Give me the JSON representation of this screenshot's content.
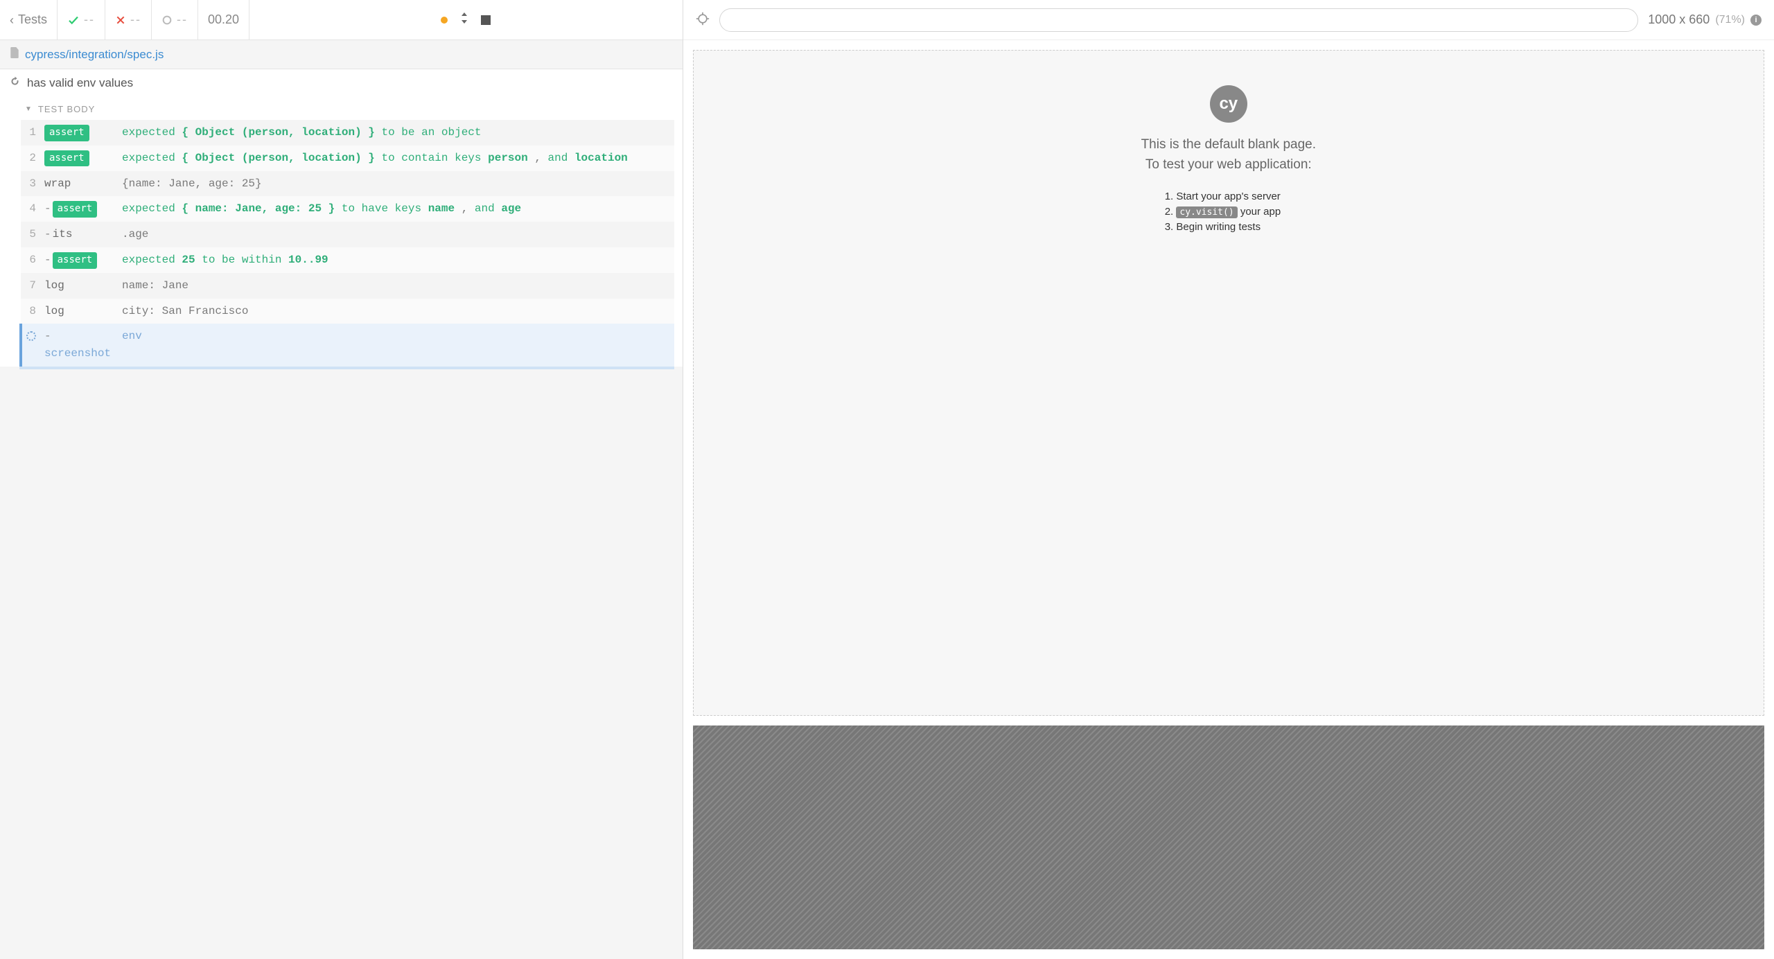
{
  "header": {
    "back_label": "Tests",
    "passed": "--",
    "failed": "--",
    "pending": "--",
    "timer": "00.20"
  },
  "spec": {
    "path": "cypress/integration/spec.js"
  },
  "test": {
    "title": "has valid env values",
    "body_label": "TEST BODY"
  },
  "commands": [
    {
      "num": "1",
      "type": "assert",
      "child": false,
      "msg_parts": [
        {
          "t": "kw",
          "v": "expected "
        },
        {
          "t": "obj",
          "v": "{ Object (person, location) }"
        },
        {
          "t": "kw",
          "v": " to be an object"
        }
      ]
    },
    {
      "num": "2",
      "type": "assert",
      "child": false,
      "msg_parts": [
        {
          "t": "kw",
          "v": "expected "
        },
        {
          "t": "obj",
          "v": "{ Object (person, location) }"
        },
        {
          "t": "kw",
          "v": " to contain keys "
        },
        {
          "t": "obj",
          "v": "person"
        },
        {
          "t": "dim",
          "v": " , "
        },
        {
          "t": "and",
          "v": "and"
        },
        {
          "t": "dim",
          "v": " "
        },
        {
          "t": "obj",
          "v": "location"
        }
      ]
    },
    {
      "num": "3",
      "type": "plain",
      "name": "wrap",
      "child": false,
      "msg_parts": [
        {
          "t": "dim",
          "v": "{name: Jane, age: 25}"
        }
      ]
    },
    {
      "num": "4",
      "type": "assert",
      "child": true,
      "msg_parts": [
        {
          "t": "kw",
          "v": "expected "
        },
        {
          "t": "obj",
          "v": "{ name: Jane, age: 25 }"
        },
        {
          "t": "kw",
          "v": " to have keys "
        },
        {
          "t": "obj",
          "v": "name"
        },
        {
          "t": "dim",
          "v": " , "
        },
        {
          "t": "and",
          "v": "and"
        },
        {
          "t": "dim",
          "v": " "
        },
        {
          "t": "obj",
          "v": "age"
        }
      ]
    },
    {
      "num": "5",
      "type": "plain",
      "name": "its",
      "child": true,
      "msg_parts": [
        {
          "t": "dim",
          "v": ".age"
        }
      ]
    },
    {
      "num": "6",
      "type": "assert",
      "child": true,
      "msg_parts": [
        {
          "t": "kw",
          "v": "expected "
        },
        {
          "t": "obj",
          "v": "25"
        },
        {
          "t": "kw",
          "v": " to be within "
        },
        {
          "t": "obj",
          "v": "10..99"
        }
      ]
    },
    {
      "num": "7",
      "type": "plain",
      "name": "log",
      "child": false,
      "msg_parts": [
        {
          "t": "dim",
          "v": "name: Jane"
        }
      ]
    },
    {
      "num": "8",
      "type": "plain",
      "name": "log",
      "child": false,
      "msg_parts": [
        {
          "t": "dim",
          "v": "city: San Francisco"
        }
      ]
    }
  ],
  "pending_command": {
    "name": "screenshot",
    "child": true,
    "msg": "env"
  },
  "aut": {
    "viewport": "1000 x 660",
    "scale": "(71%)",
    "blank_line1": "This is the default blank page.",
    "blank_line2": "To test your web application:",
    "step1": "Start your app's server",
    "step2_code": "cy.visit()",
    "step2_suffix": " your app",
    "step3": "Begin writing tests"
  }
}
